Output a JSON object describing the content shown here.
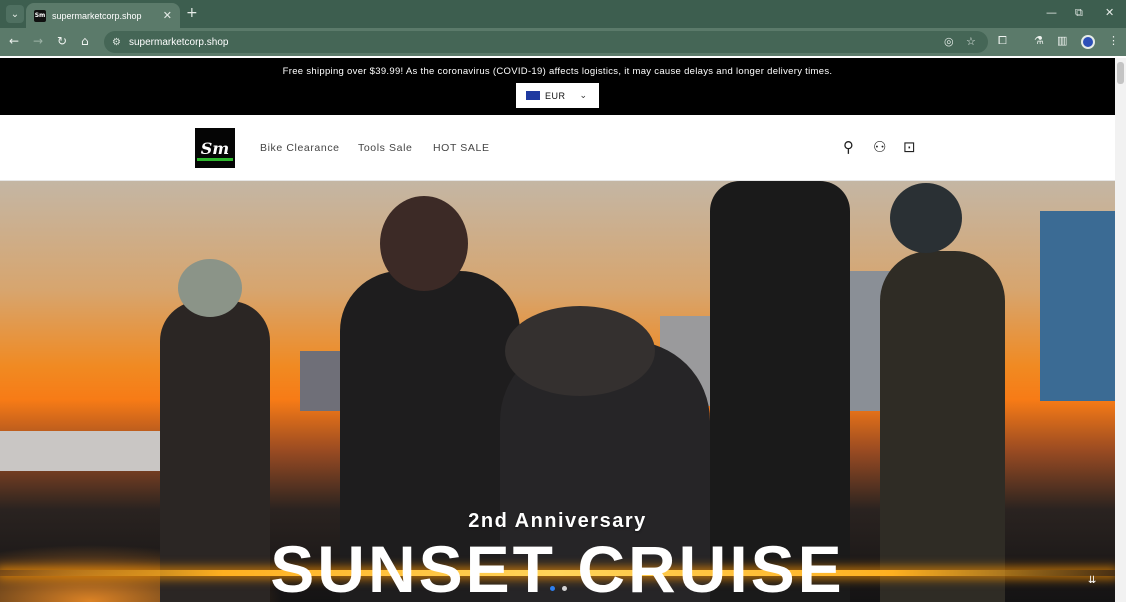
{
  "browser": {
    "tab_list_glyph": "⌄",
    "tab": {
      "favicon_text": "Sm",
      "title": "supermarketcorp.shop",
      "close_glyph": "✕"
    },
    "new_tab_glyph": "+",
    "window_controls": {
      "minimize": "—",
      "restore": "⧉",
      "close": "✕"
    },
    "nav": {
      "back": "←",
      "forward": "→",
      "reload": "↻",
      "home": "⌂"
    },
    "site_info_glyph": "⚙",
    "url": "supermarketcorp.shop",
    "omnibox_icons": {
      "eye_off": "◎",
      "bookmark": "☆"
    },
    "toolbar_icons": {
      "extensions": "⧠",
      "labs": "⚗",
      "sidepanel": "▥",
      "menu": "⋮"
    }
  },
  "announcement": {
    "text": "Free shipping over $39.99! As the coronavirus (COVID-19) affects logistics, it may cause delays and longer delivery times.",
    "currency": "EUR",
    "currency_chevron": "⌄"
  },
  "header": {
    "logo_text": "Sm",
    "menu": [
      {
        "label": "Bike Clearance"
      },
      {
        "label": "Tools Sale"
      },
      {
        "label": "HOT SALE"
      }
    ],
    "icons": {
      "search": "⚲",
      "account": "⚇",
      "cart": "⊡"
    }
  },
  "hero": {
    "subtitle": "2nd Anniversary",
    "title": "SUNSET CRUISE",
    "slides": 2,
    "active_slide": 1,
    "corner_glyph": "⇊"
  },
  "colors": {
    "browser_chrome": "#3d5e4f",
    "announcement_bg": "#000000",
    "active_dot": "#2d7ff0"
  }
}
